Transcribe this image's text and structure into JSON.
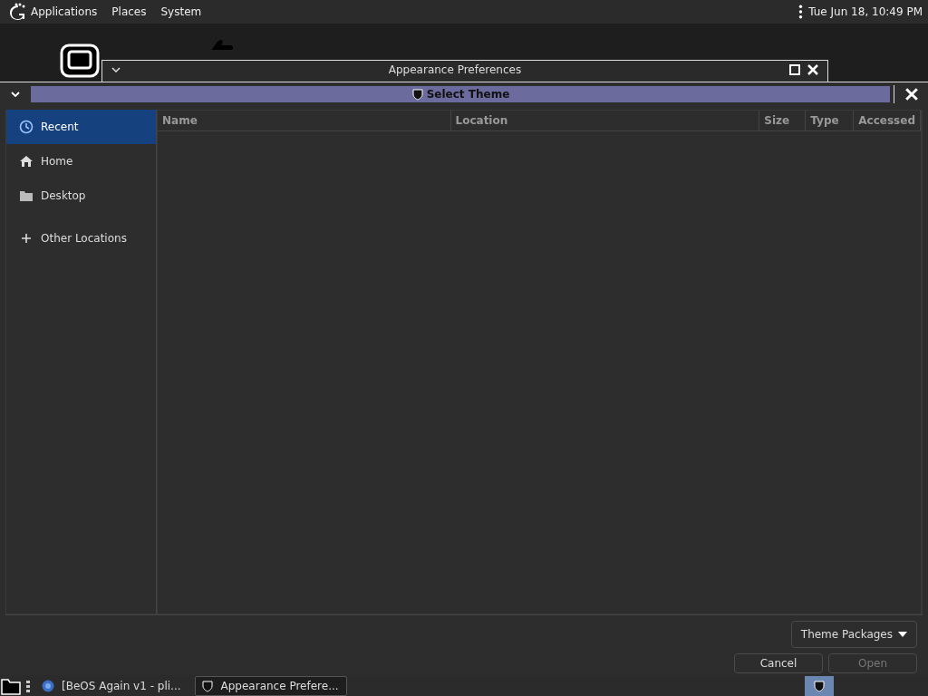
{
  "top_panel": {
    "menus": [
      "Applications",
      "Places",
      "System"
    ],
    "clock": "Tue Jun 18, 10:49 PM"
  },
  "background_window": {
    "title": "Appearance Preferences"
  },
  "dialog": {
    "title": "Select Theme",
    "sidebar": {
      "items": [
        {
          "label": "Recent",
          "selected": true
        },
        {
          "label": "Home",
          "selected": false
        },
        {
          "label": "Desktop",
          "selected": false
        },
        {
          "label": "Other Locations",
          "selected": false
        }
      ]
    },
    "table": {
      "columns": [
        "Name",
        "Location",
        "Size",
        "Type",
        "Accessed"
      ]
    },
    "filter": {
      "value": "Theme Packages"
    },
    "buttons": [
      {
        "label": "Cancel",
        "disabled": false
      },
      {
        "label": "Open",
        "disabled": true
      }
    ]
  },
  "taskbar": {
    "tasks": [
      {
        "label": "[BeOS Again v1 - pli...",
        "selected": false
      },
      {
        "label": "Appearance Prefere...",
        "selected": true
      }
    ]
  }
}
